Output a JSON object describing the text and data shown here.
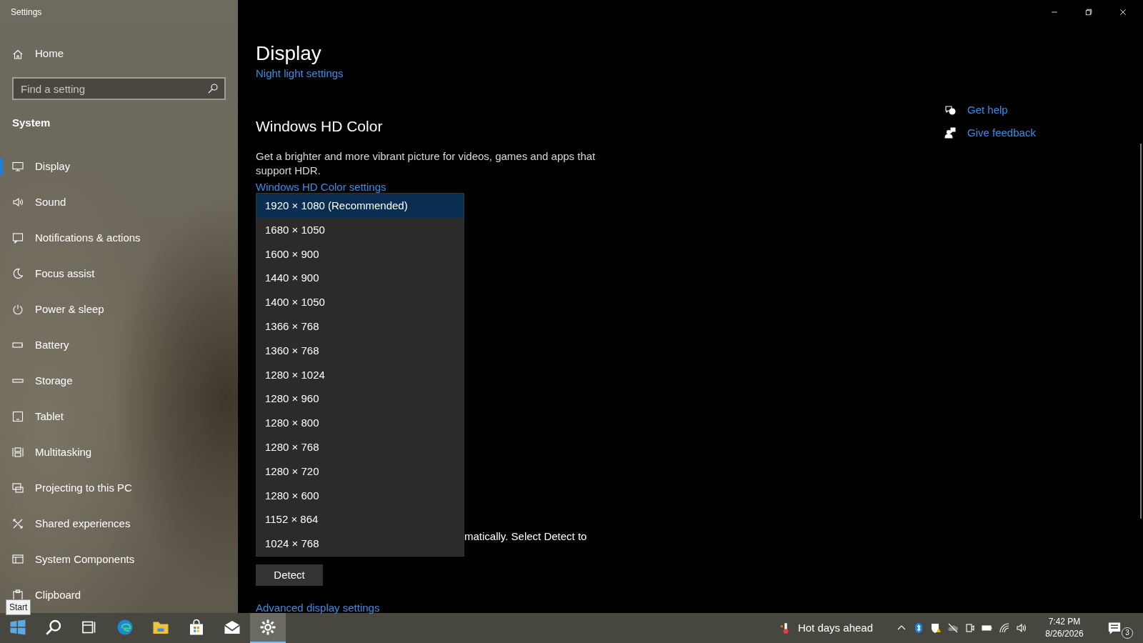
{
  "window": {
    "title": "Settings"
  },
  "sidebar": {
    "home": "Home",
    "search": {
      "placeholder": "Find a setting"
    },
    "section": "System",
    "items": [
      {
        "label": "Display",
        "selected": true
      },
      {
        "label": "Sound",
        "selected": false
      },
      {
        "label": "Notifications & actions",
        "selected": false
      },
      {
        "label": "Focus assist",
        "selected": false
      },
      {
        "label": "Power & sleep",
        "selected": false
      },
      {
        "label": "Battery",
        "selected": false
      },
      {
        "label": "Storage",
        "selected": false
      },
      {
        "label": "Tablet",
        "selected": false
      },
      {
        "label": "Multitasking",
        "selected": false
      },
      {
        "label": "Projecting to this PC",
        "selected": false
      },
      {
        "label": "Shared experiences",
        "selected": false
      },
      {
        "label": "System Components",
        "selected": false
      },
      {
        "label": "Clipboard",
        "selected": false
      }
    ]
  },
  "page": {
    "title": "Display",
    "night_light_link": "Night light settings",
    "hd_color": {
      "heading": "Windows HD Color",
      "description": "Get a brighter and more vibrant picture for videos, games and apps that support HDR.",
      "link": "Windows HD Color settings"
    },
    "detect_text": "matically. Select Detect to",
    "detect_button": "Detect",
    "advanced_link": "Advanced display settings"
  },
  "resolution_dropdown": {
    "options": [
      {
        "label": "1920 × 1080 (Recommended)",
        "selected": true
      },
      {
        "label": "1680 × 1050",
        "selected": false
      },
      {
        "label": "1600 × 900",
        "selected": false
      },
      {
        "label": "1440 × 900",
        "selected": false
      },
      {
        "label": "1400 × 1050",
        "selected": false
      },
      {
        "label": "1366 × 768",
        "selected": false
      },
      {
        "label": "1360 × 768",
        "selected": false
      },
      {
        "label": "1280 × 1024",
        "selected": false
      },
      {
        "label": "1280 × 960",
        "selected": false
      },
      {
        "label": "1280 × 800",
        "selected": false
      },
      {
        "label": "1280 × 768",
        "selected": false
      },
      {
        "label": "1280 × 720",
        "selected": false
      },
      {
        "label": "1280 × 600",
        "selected": false
      },
      {
        "label": "1152 × 864",
        "selected": false
      },
      {
        "label": "1024 × 768",
        "selected": false
      }
    ]
  },
  "help": [
    {
      "kind": "help",
      "label": "Get help"
    },
    {
      "kind": "feedback",
      "label": "Give feedback"
    }
  ],
  "tooltip": "Start",
  "taskbar": {
    "apps": [
      {
        "kind": "start",
        "selected": false
      },
      {
        "kind": "search",
        "selected": false
      },
      {
        "kind": "taskview",
        "selected": false
      },
      {
        "kind": "browser",
        "selected": false
      },
      {
        "kind": "folder",
        "selected": false
      },
      {
        "kind": "store",
        "selected": false
      },
      {
        "kind": "mail",
        "selected": false
      },
      {
        "kind": "settings",
        "selected": true
      }
    ],
    "weather": "Hot days ahead",
    "time": "7:42 PM",
    "date": "8/26/2026",
    "notifications": "3"
  }
}
